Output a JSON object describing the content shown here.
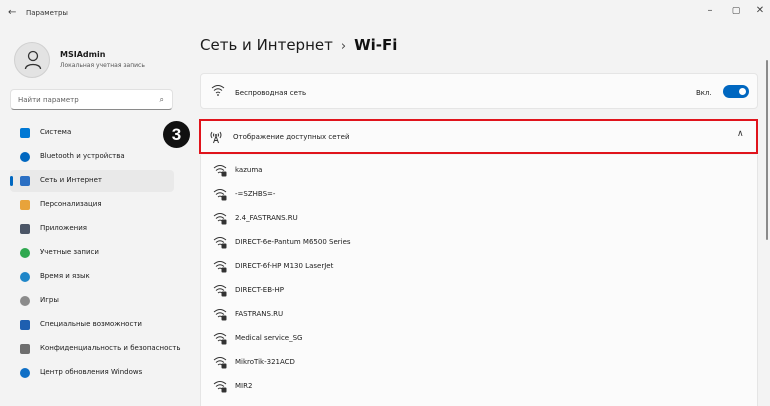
{
  "window": {
    "title": "Параметры",
    "controls": {
      "minimize": "–",
      "maximize": "▢",
      "close": "✕",
      "back": "←"
    }
  },
  "account": {
    "name": "MSIAdmin",
    "subtitle": "Локальная учетная запись",
    "icon": "person-icon"
  },
  "search": {
    "placeholder": "Найти параметр",
    "icon": "search-icon"
  },
  "sidebar": {
    "items": [
      {
        "label": "Система",
        "icon": "system-icon",
        "color": "#0078d4"
      },
      {
        "label": "Bluetooth и устройства",
        "icon": "bluetooth-icon",
        "color": "#0067c0"
      },
      {
        "label": "Сеть и Интернет",
        "icon": "network-icon",
        "color": "#2b6fc3"
      },
      {
        "label": "Персонализация",
        "icon": "brush-icon",
        "color": "#e8a33a"
      },
      {
        "label": "Приложения",
        "icon": "apps-icon",
        "color": "#4c5667"
      },
      {
        "label": "Учетные записи",
        "icon": "accounts-icon",
        "color": "#2fa84f"
      },
      {
        "label": "Время и язык",
        "icon": "time-language-icon",
        "color": "#1f86c8"
      },
      {
        "label": "Игры",
        "icon": "gaming-icon",
        "color": "#8b8b8b"
      },
      {
        "label": "Специальные возможности",
        "icon": "accessibility-icon",
        "color": "#1e5fb0"
      },
      {
        "label": "Конфиденциальность и безопасность",
        "icon": "shield-icon",
        "color": "#6e6e6e"
      },
      {
        "label": "Центр обновления Windows",
        "icon": "update-icon",
        "color": "#0f6fc6"
      }
    ],
    "active_index": 2
  },
  "header": {
    "parent": "Сеть и Интернет",
    "separator": "›",
    "current": "Wi-Fi"
  },
  "wifi": {
    "wireless_label": "Беспроводная сеть",
    "toggle_text": "Вкл.",
    "toggle_on": true,
    "show_networks_label": "Отображение доступных сетей",
    "expanded": true,
    "step_badge": "3",
    "accent": "#0067c0",
    "highlight_color": "#e0141c"
  },
  "networks": [
    {
      "name": "kazuma"
    },
    {
      "name": "-=SZHBS=-"
    },
    {
      "name": "2.4_FASTRANS.RU"
    },
    {
      "name": "DIRECT-6e-Pantum M6500 Series"
    },
    {
      "name": "DIRECT-6f-HP M130 LaserJet"
    },
    {
      "name": "DIRECT-EB-HP"
    },
    {
      "name": "FASTRANS.RU"
    },
    {
      "name": "Medical service_SG"
    },
    {
      "name": "MikroTik-321ACD"
    },
    {
      "name": "MIR2"
    }
  ]
}
